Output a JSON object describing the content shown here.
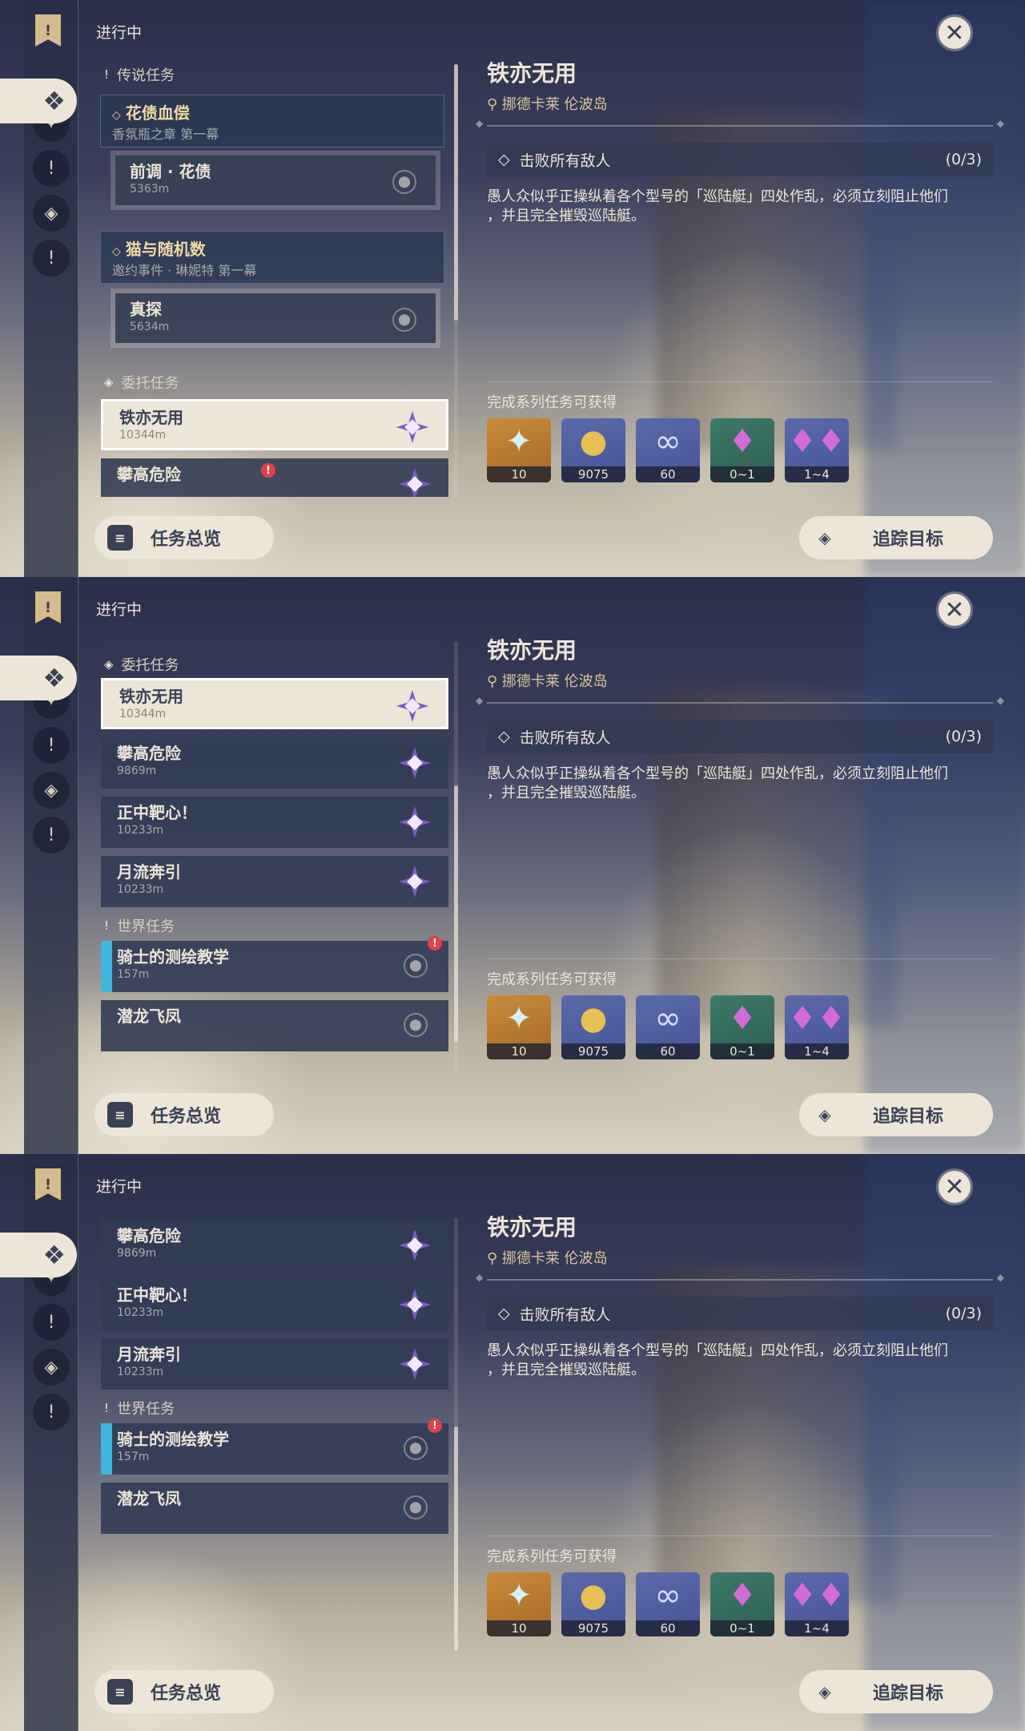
{
  "header": {
    "label": "进行中"
  },
  "detail": {
    "title": "铁亦无用",
    "location": "挪德卡莱 伦波岛",
    "objective": "击败所有敌人",
    "progress": "(0/3)",
    "description_1": "愚人众似乎正操纵着各个型号的「巡陆艇」四处作乱，必须立刻阻止他们",
    "description_2": "，并且完全摧毁巡陆艇。",
    "rewards_label": "完成系列任务可获得"
  },
  "rewards": [
    {
      "icon": "primogem-icon",
      "count": "10"
    },
    {
      "icon": "mora-icon",
      "count": "9075"
    },
    {
      "icon": "intertwined-fate-icon",
      "count": "60"
    },
    {
      "icon": "crystal-icon",
      "count": "0~1"
    },
    {
      "icon": "crystal-cluster-icon",
      "count": "1~4"
    }
  ],
  "buttons": {
    "overview": "任务总览",
    "track": "追踪目标"
  },
  "categories": {
    "legend": "传说任务",
    "commission": "委托任务",
    "world": "世界任务"
  },
  "chapters": [
    {
      "title": "花债血偿",
      "subtitle": "香氛瓶之章 第一幕"
    },
    {
      "title": "猫与随机数",
      "subtitle": "邀约事件 · 琳妮特 第一幕"
    }
  ],
  "subquests": [
    {
      "name": "前调 · 花债",
      "distance": "5363m"
    },
    {
      "name": "真探",
      "distance": "5634m"
    }
  ],
  "commissions": [
    {
      "name": "铁亦无用",
      "distance": "10344m"
    },
    {
      "name": "攀高危险",
      "distance": "9869m"
    },
    {
      "name": "正中靶心！",
      "distance": "10233m"
    },
    {
      "name": "月流奔引",
      "distance": "10233m"
    }
  ],
  "world": [
    {
      "name": "骑士的测绘教学",
      "distance": "157m"
    },
    {
      "name": "潜龙飞凤",
      "distance": ""
    }
  ]
}
